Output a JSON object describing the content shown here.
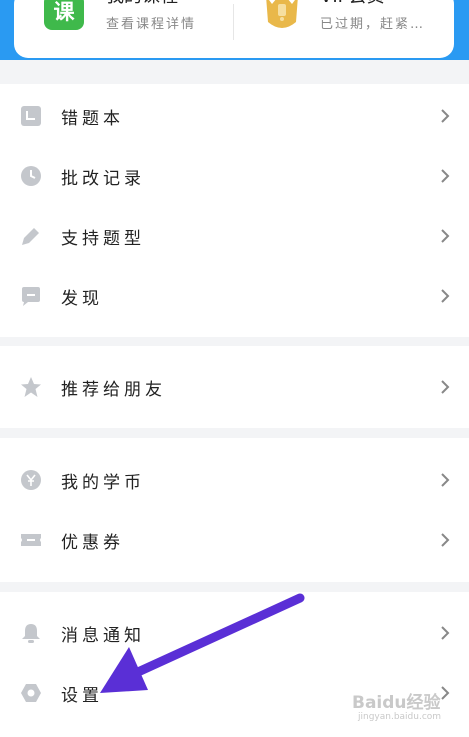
{
  "top_card": {
    "courses": {
      "title": "我的课程",
      "subtitle": "查看课程详情",
      "icon": "课"
    },
    "vip": {
      "title": "VIP会员",
      "subtitle": "已过期，赶紧…"
    }
  },
  "sections": [
    {
      "items": [
        {
          "label": "错题本",
          "icon": "notebook-icon"
        },
        {
          "label": "批改记录",
          "icon": "clock-icon"
        },
        {
          "label": "支持题型",
          "icon": "pencil-icon"
        },
        {
          "label": "发现",
          "icon": "chat-icon"
        }
      ]
    },
    {
      "items": [
        {
          "label": "推荐给朋友",
          "icon": "star-icon"
        }
      ]
    },
    {
      "items": [
        {
          "label": "我的学币",
          "icon": "coin-icon"
        },
        {
          "label": "优惠券",
          "icon": "ticket-icon"
        }
      ]
    },
    {
      "items": [
        {
          "label": "消息通知",
          "icon": "bell-icon"
        },
        {
          "label": "设置",
          "icon": "settings-icon"
        }
      ]
    }
  ],
  "colors": {
    "header_blue": "#2a9af2",
    "icon_gray": "#c4c7cc",
    "annotation_arrow": "#5a2fd6"
  },
  "watermark": {
    "text": "Baidu经验",
    "sub": "jingyan.baidu.com"
  }
}
